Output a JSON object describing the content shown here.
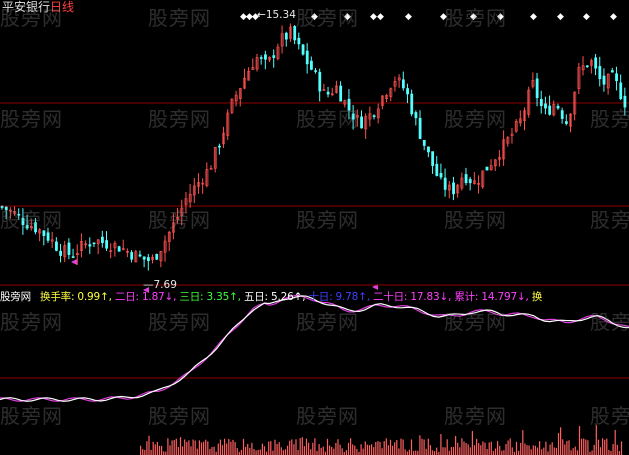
{
  "title": {
    "name": "平安银行",
    "period": "日线"
  },
  "watermark": "股旁网",
  "annotations": {
    "high": "15.34",
    "low": "7.69"
  },
  "indicator_bar": {
    "name": "股旁网",
    "items": [
      {
        "label": "换手率",
        "value": "0.99",
        "arrow": "↑",
        "color": "#ffff40"
      },
      {
        "label": "二日",
        "value": "1.87",
        "arrow": "↓",
        "color": "#ff40ff"
      },
      {
        "label": "三日",
        "value": "3.35",
        "arrow": "↑",
        "color": "#40ff40"
      },
      {
        "label": "五日",
        "value": "5.26",
        "arrow": "↑",
        "color": "#ffffff"
      },
      {
        "label": "十日",
        "value": "9.78",
        "arrow": "↑",
        "color": "#4040ff"
      },
      {
        "label": "二十日",
        "value": "17.83",
        "arrow": "↓",
        "color": "#ff40ff"
      },
      {
        "label": "累计",
        "value": "14.797",
        "arrow": "↓",
        "color": "#ff40ff"
      }
    ],
    "trailing": "换"
  },
  "colors": {
    "up": "#ff5050",
    "down": "#54ffff",
    "gridline": "#8b0000",
    "line_white": "#ffffff",
    "line_magenta": "#e040e0",
    "volume": "#ff6060",
    "marker": "#e040e0"
  },
  "chart_data": {
    "type": "candlestick",
    "price_range": [
      7.69,
      15.34
    ],
    "candles_close_sample": [
      9.5,
      9.3,
      9.0,
      8.8,
      8.5,
      8.1,
      7.9,
      8.2,
      8.4,
      8.3,
      8.2,
      8.0,
      7.8,
      7.7,
      8.3,
      9.0,
      9.8,
      10.3,
      10.8,
      11.8,
      13.0,
      13.8,
      14.5,
      14.2,
      15.0,
      15.3,
      14.6,
      14.0,
      13.2,
      13.5,
      12.8,
      12.3,
      12.6,
      13.2,
      13.8,
      13.4,
      12.2,
      11.2,
      10.3,
      10.0,
      10.6,
      10.3,
      10.8,
      11.3,
      11.8,
      12.4,
      13.6,
      12.6,
      13.0,
      12.3,
      14.0,
      14.4,
      13.6,
      13.8,
      13.0
    ],
    "turnover_cumulative": [
      0.25,
      0.25,
      0.25,
      0.25,
      0.26,
      0.3,
      0.42,
      0.62,
      0.85,
      0.93,
      0.9,
      0.86,
      0.88,
      0.84,
      0.82,
      0.84,
      0.8,
      0.82,
      0.77,
      0.78,
      0.74
    ]
  }
}
